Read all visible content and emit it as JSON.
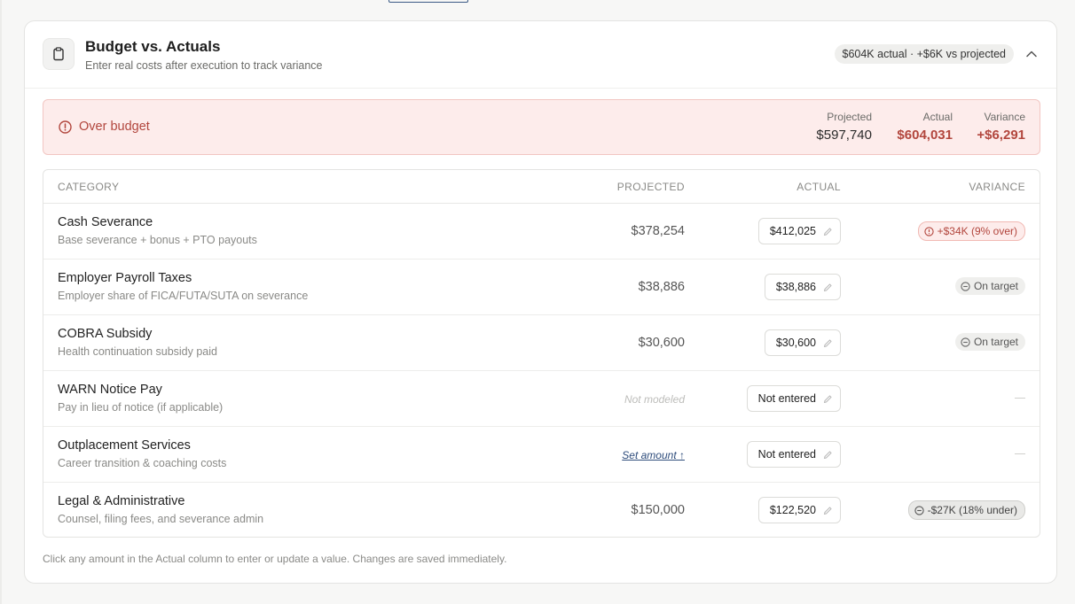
{
  "card": {
    "title": "Budget vs. Actuals",
    "subtitle": "Enter real costs after execution to track variance",
    "summary": "$604K actual · +$6K vs projected",
    "icon": "clipboard-icon",
    "collapse_icon": "chevron-up-icon"
  },
  "alert": {
    "label": "Over budget",
    "icon": "alert-circle-icon",
    "projected_label": "Projected",
    "projected_value": "$597,740",
    "actual_label": "Actual",
    "actual_value": "$604,031",
    "variance_label": "Variance",
    "variance_value": "+$6,291",
    "accent_color": "#b2463d",
    "background_color": "#fdeceb"
  },
  "table": {
    "headers": {
      "category": "CATEGORY",
      "projected": "PROJECTED",
      "actual": "ACTUAL",
      "variance": "VARIANCE"
    },
    "rows": [
      {
        "name": "Cash Severance",
        "desc": "Base severance + bonus + PTO payouts",
        "projected": "$378,254",
        "actual": "$412,025",
        "variance": "+$34K (9% over)",
        "variance_type": "over"
      },
      {
        "name": "Employer Payroll Taxes",
        "desc": "Employer share of FICA/FUTA/SUTA on severance",
        "projected": "$38,886",
        "actual": "$38,886",
        "variance": "On target",
        "variance_type": "on"
      },
      {
        "name": "COBRA Subsidy",
        "desc": "Health continuation subsidy paid",
        "projected": "$30,600",
        "actual": "$30,600",
        "variance": "On target",
        "variance_type": "on"
      },
      {
        "name": "WARN Notice Pay",
        "desc": "Pay in lieu of notice (if applicable)",
        "projected": "Not modeled",
        "actual": "Not entered",
        "variance": "",
        "variance_type": "none"
      },
      {
        "name": "Outplacement Services",
        "desc": "Career transition & coaching costs",
        "projected": "Set amount ↑",
        "actual": "Not entered",
        "variance": "",
        "variance_type": "none"
      },
      {
        "name": "Legal & Administrative",
        "desc": "Counsel, filing fees, and severance admin",
        "projected": "$150,000",
        "actual": "$122,520",
        "variance": "-$27K (18% under)",
        "variance_type": "under"
      }
    ]
  },
  "footnote": "Click any amount in the Actual column to enter or update a value. Changes are saved immediately."
}
